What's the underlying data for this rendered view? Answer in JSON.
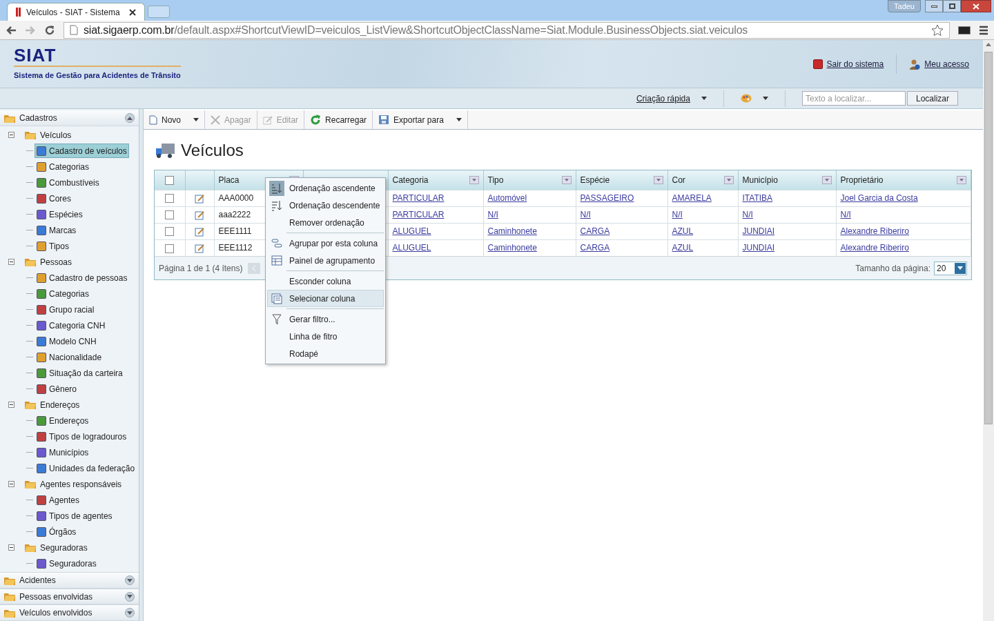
{
  "browser": {
    "tab_title": "Veículos - SIAT - Sistema",
    "user": "Tadeu",
    "url_host": "siat.sigaerp.com.br",
    "url_path": "/default.aspx#ShortcutViewID=veiculos_ListView&ShortcutObjectClassName=Siat.Module.BusinessObjects.siat.veiculos"
  },
  "header": {
    "logo": "SIAT",
    "subtitle": "Sistema de Gestão para Acidentes de Trânsito",
    "links": [
      "Sair do sistema",
      "Meu acesso"
    ],
    "quick_create": "Criação rápida",
    "search": {
      "placeholder": "Texto a localizar..."
    },
    "search_button": "Localizar"
  },
  "sidebar": [
    {
      "label": "Cadastros",
      "expanded": true,
      "children": [
        {
          "label": "Veículos",
          "expanded": true,
          "children": [
            {
              "label": "Cadastro de veículos",
              "selected": true
            },
            {
              "label": "Categorias",
              "selected": false
            },
            {
              "label": "Combustíveis",
              "selected": false
            },
            {
              "label": "Cores",
              "selected": false
            },
            {
              "label": "Espécies",
              "selected": false
            },
            {
              "label": "Marcas",
              "selected": false
            },
            {
              "label": "Tipos",
              "selected": false
            }
          ]
        },
        {
          "label": "Pessoas",
          "expanded": true,
          "children": [
            {
              "label": "Cadastro de pessoas",
              "selected": false
            },
            {
              "label": "Categorias",
              "selected": false
            },
            {
              "label": "Grupo racial",
              "selected": false
            },
            {
              "label": "Categoria CNH",
              "selected": false
            },
            {
              "label": "Modelo CNH",
              "selected": false
            },
            {
              "label": "Nacionalidade",
              "selected": false
            },
            {
              "label": "Situação da carteira",
              "selected": false
            },
            {
              "label": "Gênero",
              "selected": false
            }
          ]
        },
        {
          "label": "Endereços",
          "expanded": true,
          "children": [
            {
              "label": "Endereços",
              "selected": false
            },
            {
              "label": "Tipos de logradouros",
              "selected": false
            },
            {
              "label": "Municípios",
              "selected": false
            },
            {
              "label": "Unidades da federação",
              "selected": false
            }
          ]
        },
        {
          "label": "Agentes responsáveis",
          "expanded": true,
          "children": [
            {
              "label": "Agentes",
              "selected": false
            },
            {
              "label": "Tipos de agentes",
              "selected": false
            },
            {
              "label": "Órgãos",
              "selected": false
            }
          ]
        },
        {
          "label": "Seguradoras",
          "expanded": true,
          "children": [
            {
              "label": "Seguradoras",
              "selected": false
            }
          ]
        }
      ]
    },
    {
      "label": "Acidentes",
      "expanded": false
    },
    {
      "label": "Pessoas envolvidas",
      "expanded": false
    },
    {
      "label": "Veículos envolvidos",
      "expanded": false
    }
  ],
  "toolbar": [
    {
      "label": "Novo",
      "disabled": false,
      "dropdown": true
    },
    {
      "label": "Apagar",
      "disabled": true,
      "dropdown": false
    },
    {
      "label": "Editar",
      "disabled": true,
      "dropdown": false
    },
    {
      "label": "Recarregar",
      "disabled": false,
      "dropdown": false
    },
    {
      "label": "Exportar para",
      "disabled": false,
      "dropdown": true
    }
  ],
  "page_title": "Veículos",
  "table": {
    "select_all_checked": false,
    "columns": [
      "Placa",
      "Categoria",
      "Tipo",
      "Espécie",
      "Cor",
      "Município",
      "Proprietário"
    ],
    "rows": [
      {
        "checked": false,
        "cells": [
          "AAA0000",
          "PARTICULAR",
          "Automóvel",
          "PASSAGEIRO",
          "AMARELA",
          "ITATIBA",
          "Joel Garcia da Costa"
        ]
      },
      {
        "checked": false,
        "cells": [
          "aaa2222",
          "PARTICULAR",
          "N/I",
          "N/I",
          "N/I",
          "N/I",
          "N/I"
        ]
      },
      {
        "checked": false,
        "cells": [
          "EEE1111",
          "ALUGUEL",
          "Caminhonete",
          "CARGA",
          "AZUL",
          "JUNDIAI",
          "Alexandre Riberiro"
        ]
      },
      {
        "checked": false,
        "cells": [
          "EEE1112",
          "ALUGUEL",
          "Caminhonete",
          "CARGA",
          "AZUL",
          "JUNDIAI",
          "Alexandre Riberiro"
        ]
      }
    ],
    "pager": "Página 1 de 1 (4 ítens)",
    "page_size_label": "Tamanho da página:",
    "page_size": "20"
  },
  "context_menu": [
    [
      {
        "label": "Ordenação ascendente",
        "checked": true,
        "selected": false
      },
      {
        "label": "Ordenação descendente",
        "checked": false,
        "selected": false
      },
      {
        "label": "Remover ordenação",
        "checked": false,
        "selected": false
      }
    ],
    [
      {
        "label": "Agrupar por esta coluna",
        "checked": false,
        "selected": false
      },
      {
        "label": "Painel de agrupamento",
        "checked": false,
        "selected": false
      }
    ],
    [
      {
        "label": "Esconder coluna",
        "checked": false,
        "selected": false
      },
      {
        "label": "Selecionar coluna",
        "checked": false,
        "selected": true
      }
    ],
    [
      {
        "label": "Gerar filtro...",
        "checked": false,
        "selected": false
      },
      {
        "label": "Linha de fitro",
        "checked": false,
        "selected": false
      },
      {
        "label": "Rodapé",
        "checked": false,
        "selected": false
      }
    ]
  ]
}
